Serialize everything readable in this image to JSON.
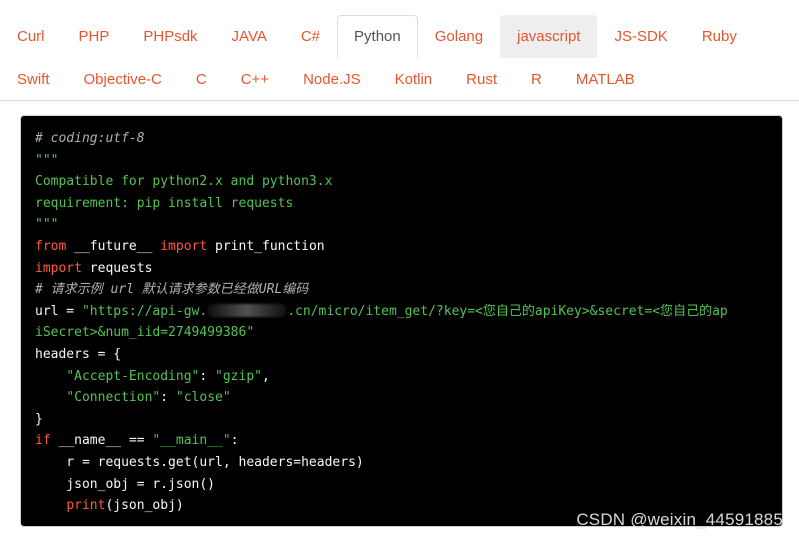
{
  "tabs": {
    "row1": [
      "Curl",
      "PHP",
      "PHPsdk",
      "JAVA",
      "C#",
      "Python",
      "Golang",
      "javascript",
      "JS-SDK",
      "Ruby"
    ],
    "row2": [
      "Swift",
      "Objective-C",
      "C",
      "C++",
      "Node.JS",
      "Kotlin",
      "Rust",
      "R",
      "MATLAB"
    ],
    "active": "Python",
    "hovered": "javascript"
  },
  "code": {
    "l1": "# coding:utf-8",
    "l2": "\"\"\"",
    "l3": "Compatible for python2.x and python3.x",
    "l4": "requirement: pip install requests",
    "l5": "\"\"\"",
    "kw_from": "from",
    "future": " __future__ ",
    "kw_import": "import",
    "print_function": " print_function",
    "import_requests_name": " requests",
    "comment_url": "# 请求示例 url 默认请求参数已经做URL编码",
    "url_assign": "url = ",
    "url_str_a": "\"https://api-gw.",
    "url_str_b": ".cn/micro/item_get/?key=<您自己的apiKey>&secret=<您自己的ap",
    "url_str_c": "iSecret>&num_iid=2749499386\"",
    "headers_open": "headers = {",
    "k1": "\"Accept-Encoding\"",
    "v1": "\"gzip\"",
    "k2": "\"Connection\"",
    "v2": "\"close\"",
    "close_brace": "}",
    "kw_if": "if",
    "name_cmp": " __name__ == ",
    "main_str": "\"__main__\"",
    "colon": ":",
    "r_line": "    r = requests.get(url, headers=headers)",
    "json_line": "    json_obj = r.json()",
    "print_fn": "print",
    "print_arg": "(json_obj)"
  },
  "watermark": "CSDN @weixin_44591885",
  "colors": {
    "tab_text": "#e4572e",
    "active_tab_text": "#555555",
    "code_bg": "#000000",
    "string": "#52c352",
    "keyword": "#ff5a3c",
    "comment": "#b0b0b0"
  }
}
